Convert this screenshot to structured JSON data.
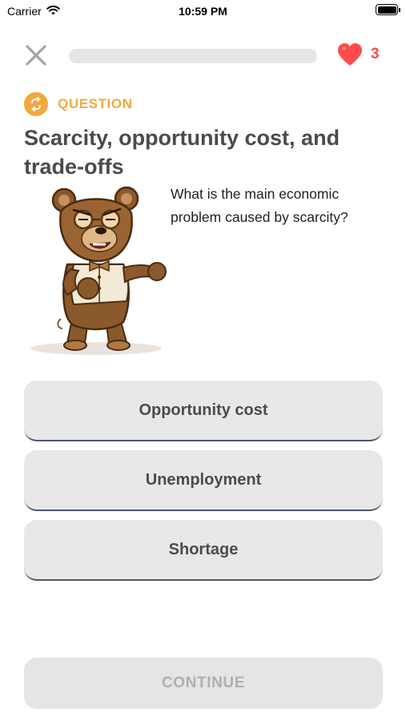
{
  "status_bar": {
    "carrier": "Carrier",
    "time": "10:59 PM",
    "battery_level": 1.0
  },
  "top_bar": {
    "close_icon": "close-icon",
    "progress": 0.0,
    "lives_icon": "heart-icon",
    "lives_count": "3"
  },
  "question": {
    "label": "QUESTION",
    "badge_icon": "swap-icon",
    "title": "Scarcity, opportunity cost, and trade-offs",
    "prompt": "What is the main economic problem caused by scarcity?",
    "mascot": "bear-mascot"
  },
  "options": [
    {
      "label": "Opportunity cost"
    },
    {
      "label": "Unemployment"
    },
    {
      "label": "Shortage"
    }
  ],
  "continue_label": "CONTINUE",
  "colors": {
    "accent": "#f2a740",
    "heart": "#ff4b4b",
    "option_bg": "#e8e8e8",
    "option_border": "#4b5868",
    "disabled_text": "#afafaf"
  }
}
